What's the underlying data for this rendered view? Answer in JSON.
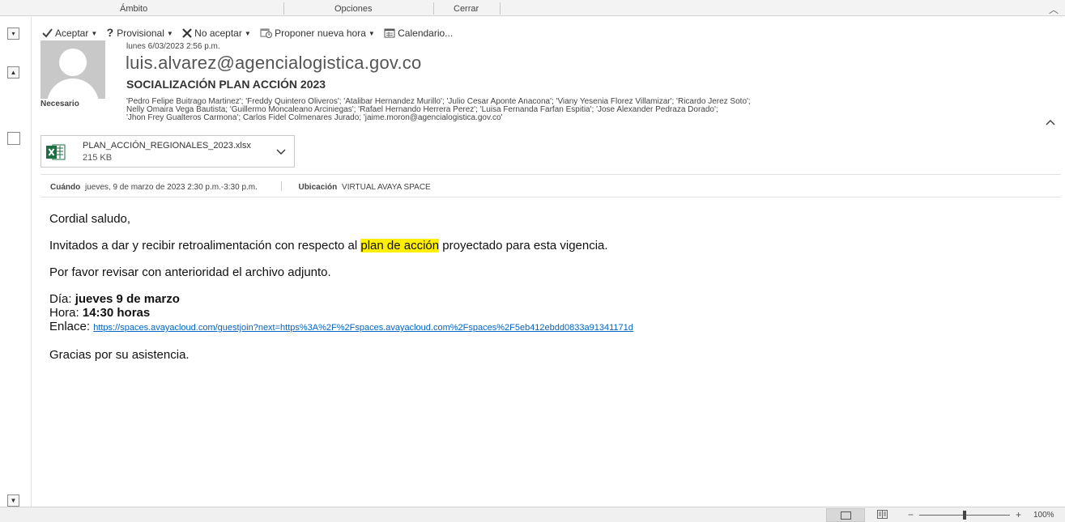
{
  "ribbon": {
    "groups": [
      "Ámbito",
      "Opciones",
      "Cerrar"
    ]
  },
  "toolbar": {
    "accept": "Aceptar",
    "tentative": "Provisional",
    "decline": "No aceptar",
    "propose": "Proponer nueva hora",
    "calendar": "Calendario..."
  },
  "header": {
    "sent_date": "lunes 6/03/2023 2:56 p.m.",
    "sender": "luis.alvarez@agencialogistica.gov.co",
    "subject": "SOCIALIZACIÓN PLAN ACCIÓN 2023",
    "required_label": "Necesario",
    "attendees": [
      "'Pedro Felipe Buitrago Martinez'; 'Freddy Quintero Oliveros'; 'Atalibar Hernandez Murillo'; 'Julio Cesar Aponte Anacona'; 'Viany Yesenia Florez Villamizar'; 'Ricardo Jerez Soto';",
      "Nelly Omaira Vega Bautista; 'Guillermo Moncaleano Arciniegas'; 'Rafael Hernando Herrera Perez'; 'Luisa Fernanda Farfan Espitia'; 'Jose Alexander Pedraza Dorado';",
      "'Jhon Frey Gualteros Carmona'; Carlos Fidel Colmenares Jurado; 'jaime.moron@agencialogistica.gov.co'"
    ]
  },
  "attachment": {
    "name": "PLAN_ACCIÓN_REGIONALES_2023.xlsx",
    "size": "215 KB",
    "icon": "excel-icon"
  },
  "meeting": {
    "when_label": "Cuándo",
    "when_value": "jueves, 9 de marzo de 2023 2:30 p.m.-3:30 p.m.",
    "where_label": "Ubicación",
    "where_value": "VIRTUAL AVAYA SPACE"
  },
  "body": {
    "greeting": "Cordial saludo,",
    "invite_before": "Invitados a dar y recibir retroalimentación con respecto al ",
    "invite_highlight": "plan de acción",
    "invite_after": " proyectado para esta vigencia.",
    "review": "Por favor revisar con anterioridad el archivo adjunto.",
    "day_label": "Día: ",
    "day_value": "jueves 9 de marzo",
    "time_label": "Hora: ",
    "time_value": "14:30 horas",
    "link_label": "Enlace: ",
    "link": "https://spaces.avayacloud.com/guestjoin?next=https%3A%2F%2Fspaces.avayacloud.com%2Fspaces%2F5eb412ebdd0833a91341171d",
    "thanks": "Gracias por su asistencia."
  },
  "status_bar": {
    "zoom_minus": "−",
    "zoom_plus": "+",
    "zoom_level": "100%",
    "zoom_fraction": 0.5
  },
  "colors": {
    "highlight": "#ffef00",
    "link": "#0563c1",
    "excel_green": "#1d6f42"
  }
}
